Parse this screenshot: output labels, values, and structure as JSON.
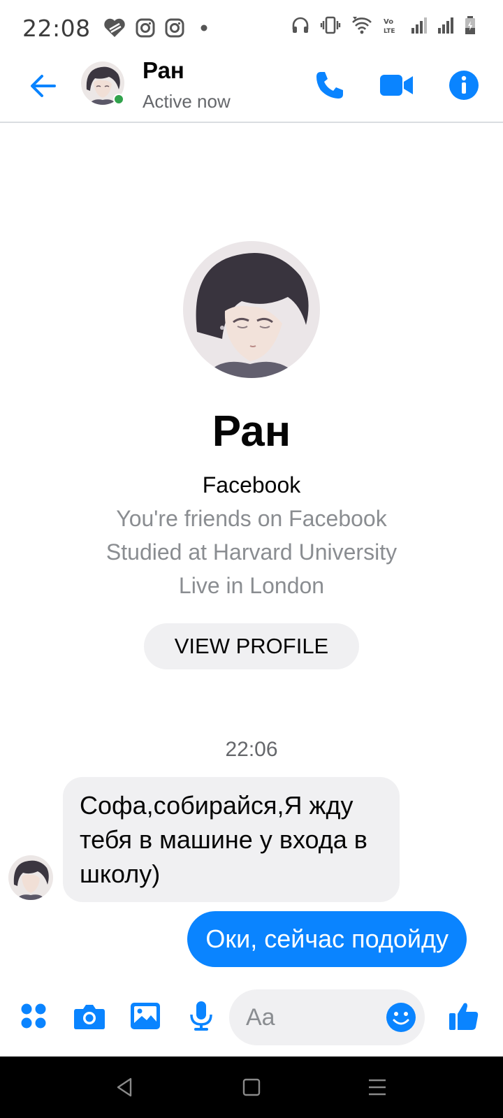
{
  "status_bar": {
    "time": "22:08",
    "left_icons": [
      "heart-app-icon",
      "instagram-icon",
      "instagram-icon",
      "dot-icon"
    ],
    "right_icons": [
      "headphones-icon",
      "vibrate-icon",
      "wifi-icon",
      "volte-icon",
      "signal-icon",
      "signal-icon",
      "battery-icon"
    ]
  },
  "header": {
    "name": "Ран",
    "status": "Active now",
    "actions": [
      "phone-icon",
      "video-camera-icon",
      "info-icon"
    ]
  },
  "profile": {
    "name": "Ран",
    "source": "Facebook",
    "lines": [
      "You're friends on Facebook",
      "Studied at Harvard University",
      "Live in London"
    ],
    "button_label": "VIEW PROFILE"
  },
  "conversation": {
    "timestamp": "22:06",
    "messages": [
      {
        "direction": "incoming",
        "text": "Софа,собирайся,Я жду тебя в машине у входа в школу)"
      },
      {
        "direction": "outgoing",
        "text": "Оки, сейчас подойду"
      }
    ]
  },
  "composer": {
    "placeholder": "Aa",
    "actions": [
      "more-icon",
      "camera-icon",
      "gallery-icon",
      "microphone-icon",
      "emoji-icon",
      "thumbs-up-icon"
    ]
  },
  "nav_bar": {
    "buttons": [
      "back-triangle-icon",
      "home-square-icon",
      "menu-lines-icon"
    ]
  },
  "colors": {
    "accent": "#0a84ff",
    "active_dot": "#31a24c",
    "bubble_incoming": "#f0f0f2",
    "secondary_text": "#8a8d91"
  }
}
